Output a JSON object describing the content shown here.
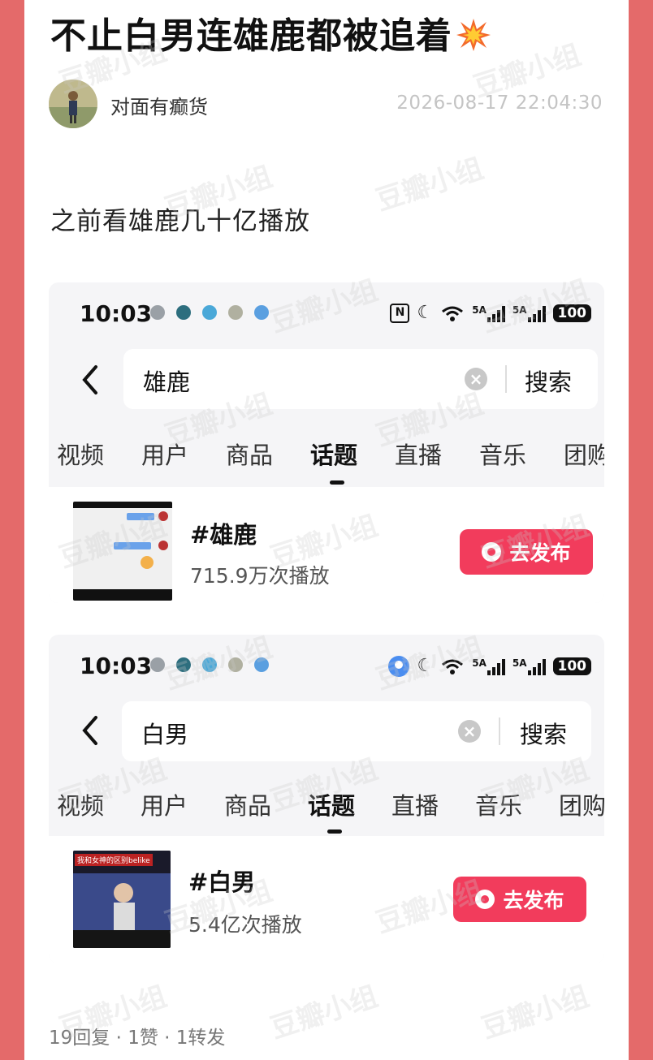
{
  "post": {
    "title": "不止白男连雄鹿都被追着",
    "title_emoji": "collision-emoji",
    "author": "对面有癫货",
    "timestamp": "2026-08-17 22:04:30",
    "body": "之前看雄鹿几十亿播放",
    "stats": "19回复 · 1赞 · 1转发",
    "watermark": "豆瓣小组"
  },
  "screenshots": [
    {
      "status": {
        "time": "10:03",
        "signal1": "5A",
        "signal2": "5A",
        "battery": "100"
      },
      "search": {
        "query": "雄鹿",
        "button": "搜索"
      },
      "tabs": [
        "视频",
        "用户",
        "商品",
        "话题",
        "直播",
        "音乐",
        "团购"
      ],
      "active_tab": "话题",
      "result": {
        "tag": "#雄鹿",
        "plays": "715.9万次播放",
        "publish_label": "去发布"
      }
    },
    {
      "status": {
        "time": "10:03",
        "signal1": "5A",
        "signal2": "5A",
        "battery": "100"
      },
      "search": {
        "query": "白男",
        "button": "搜索"
      },
      "tabs": [
        "视频",
        "用户",
        "商品",
        "话题",
        "直播",
        "音乐",
        "团购"
      ],
      "active_tab": "话题",
      "result": {
        "tag": "#白男",
        "plays": "5.4亿次播放",
        "publish_label": "去发布",
        "thumb_caption": "我和女神的区别belike"
      }
    }
  ],
  "colors": {
    "frame": "#e46a6a",
    "publish_button": "#f23c5c",
    "screenshot_bg": "#f5f5f7"
  }
}
